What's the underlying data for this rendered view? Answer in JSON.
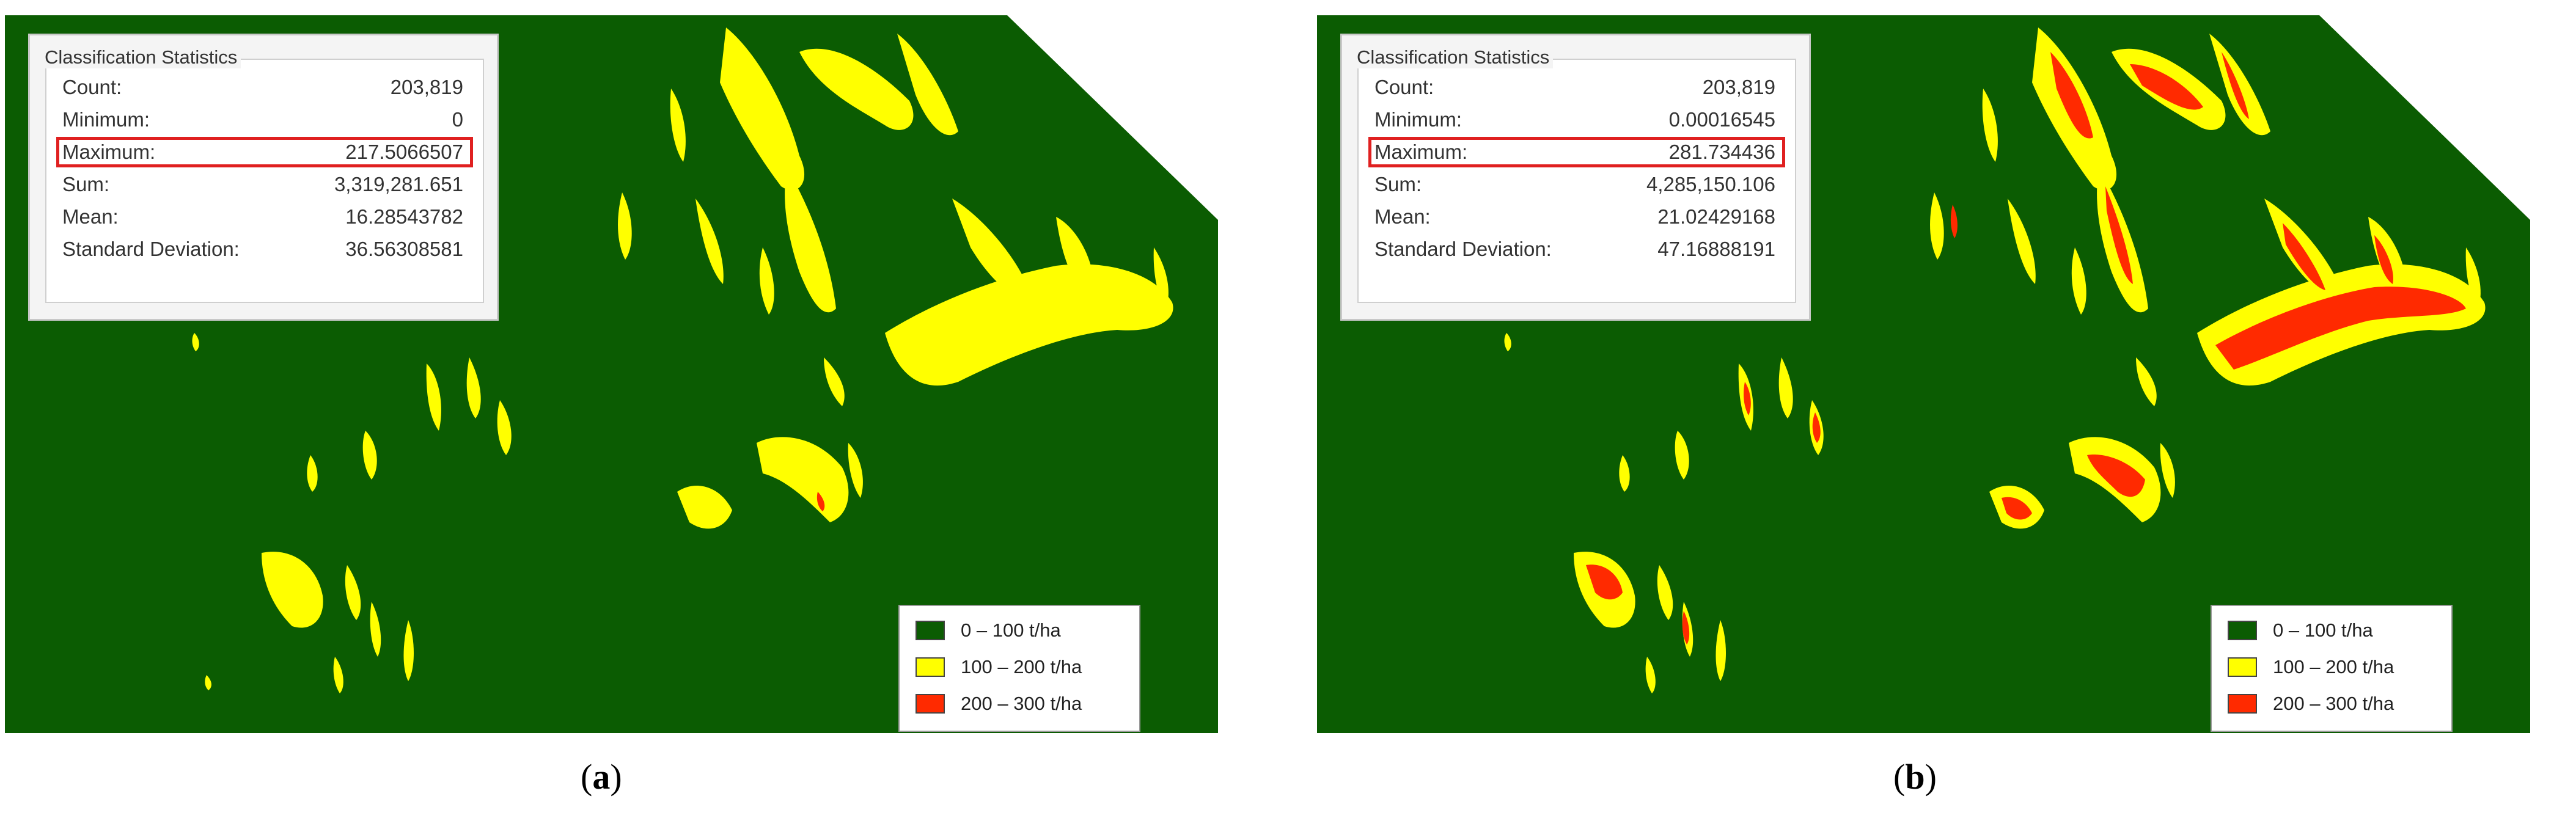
{
  "colors": {
    "class_low": "#0b5c02",
    "class_mid": "#ffff00",
    "class_high": "#ff2a00",
    "highlight": "#e02020"
  },
  "panels": [
    {
      "id": "a",
      "caption_open": "(",
      "caption_letter": "a",
      "caption_close": ")",
      "stats": {
        "title": "Classification Statistics",
        "rows": [
          {
            "label": "Count:",
            "value": "203,819"
          },
          {
            "label": "Minimum:",
            "value": "0"
          },
          {
            "label": "Maximum:",
            "value": "217.5066507"
          },
          {
            "label": "Sum:",
            "value": "3,319,281.651"
          },
          {
            "label": "Mean:",
            "value": "16.28543782"
          },
          {
            "label": "Standard Deviation:",
            "value": "36.56308581"
          }
        ],
        "highlighted_row": 2
      },
      "legend": [
        {
          "label": "0 –  100 t/ha",
          "color": "#0b5c02"
        },
        {
          "label": "100 – 200 t/ha",
          "color": "#ffff00"
        },
        {
          "label": "200 – 300 t/ha",
          "color": "#ff2a00"
        }
      ]
    },
    {
      "id": "b",
      "caption_open": "(",
      "caption_letter": "b",
      "caption_close": ")",
      "stats": {
        "title": "Classification Statistics",
        "rows": [
          {
            "label": "Count:",
            "value": "203,819"
          },
          {
            "label": "Minimum:",
            "value": "0.00016545"
          },
          {
            "label": "Maximum:",
            "value": "281.734436"
          },
          {
            "label": "Sum:",
            "value": "4,285,150.106"
          },
          {
            "label": "Mean:",
            "value": "21.02429168"
          },
          {
            "label": "Standard Deviation:",
            "value": "47.16888191"
          }
        ],
        "highlighted_row": 2
      },
      "legend": [
        {
          "label": "0 –  100 t/ha",
          "color": "#0b5c02"
        },
        {
          "label": "100 – 200 t/ha",
          "color": "#ffff00"
        },
        {
          "label": "200 – 300 t/ha",
          "color": "#ff2a00"
        }
      ]
    }
  ]
}
